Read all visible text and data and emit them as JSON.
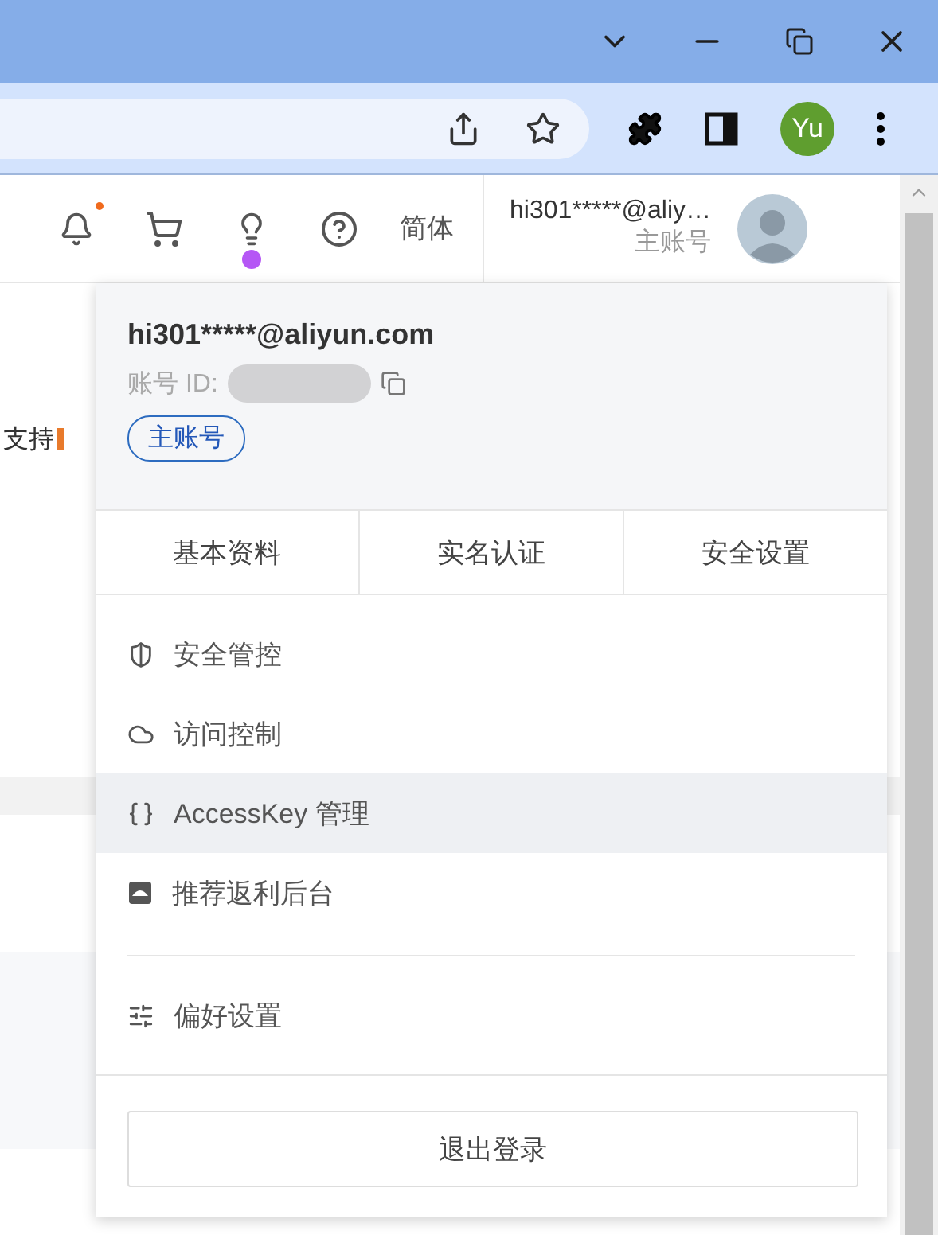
{
  "browser": {
    "profile_initials": "Yu"
  },
  "header": {
    "bell_unread": true,
    "tips_badge": true,
    "language": "简体",
    "account_name": "hi301*****@aliy…",
    "account_role": "主账号"
  },
  "background": {
    "text_top": "支持"
  },
  "dropdown": {
    "email": "hi301*****@aliyun.com",
    "id_label": "账号 ID:",
    "badge": "主账号",
    "tabs": [
      "基本资料",
      "实名认证",
      "安全设置"
    ],
    "items": [
      {
        "kind": "shield",
        "label": "安全管控",
        "highlighted": false
      },
      {
        "kind": "cloud",
        "label": "访问控制",
        "highlighted": false
      },
      {
        "kind": "key",
        "label": "AccessKey 管理",
        "highlighted": true
      },
      {
        "kind": "referral",
        "label": "推荐返利后台",
        "highlighted": false
      }
    ],
    "settings": {
      "kind": "sliders",
      "label": "偏好设置"
    },
    "logout": "退出登录"
  }
}
